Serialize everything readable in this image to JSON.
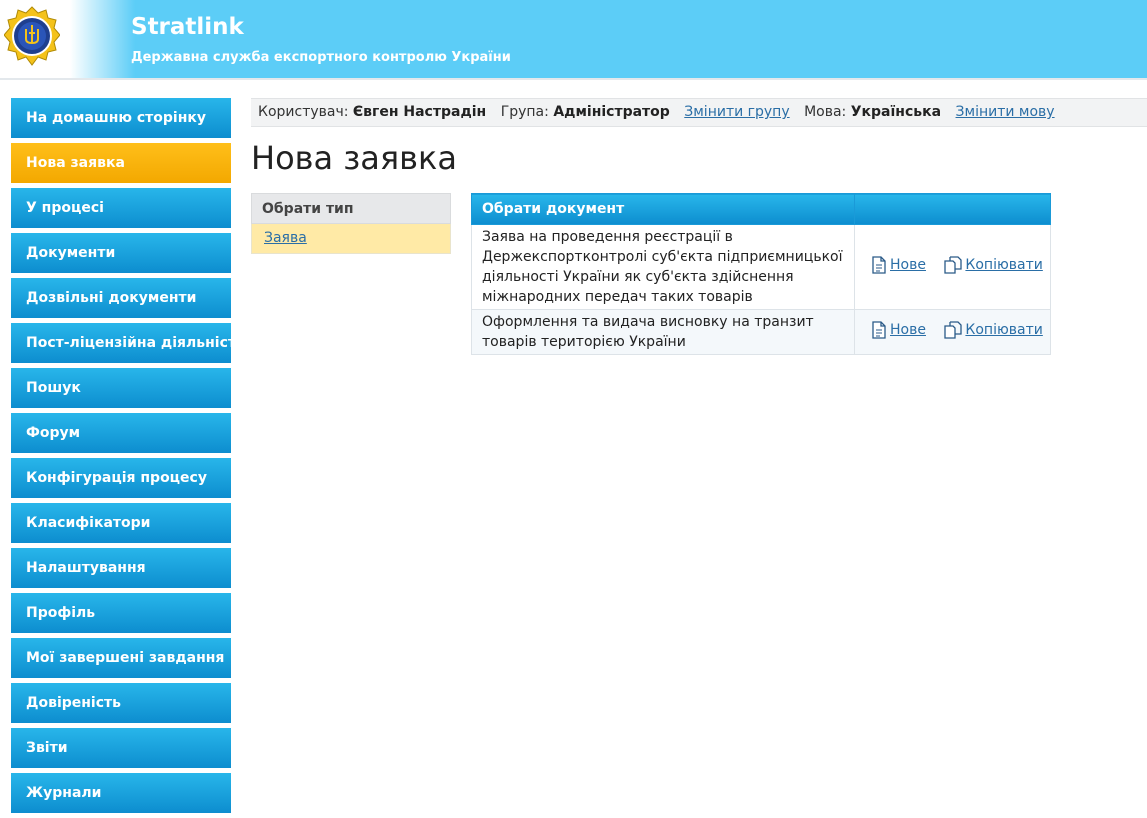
{
  "header": {
    "title": "Stratlink",
    "subtitle": "Державна служба експортного контролю України",
    "logo_icon": "ukraine-trident-emblem-icon"
  },
  "sidebar": {
    "items": [
      {
        "label": "На домашню сторінку",
        "active": false
      },
      {
        "label": "Нова заявка",
        "active": true
      },
      {
        "label": "У процесі",
        "active": false
      },
      {
        "label": "Документи",
        "active": false
      },
      {
        "label": "Дозвільні документи",
        "active": false
      },
      {
        "label": "Пост-ліцензійна діяльність",
        "active": false
      },
      {
        "label": "Пошук",
        "active": false
      },
      {
        "label": "Форум",
        "active": false
      },
      {
        "label": "Конфігурація процесу",
        "active": false
      },
      {
        "label": "Класифікатори",
        "active": false
      },
      {
        "label": "Налаштування",
        "active": false
      },
      {
        "label": "Профіль",
        "active": false
      },
      {
        "label": "Мої завершені завдання",
        "active": false
      },
      {
        "label": "Довіреність",
        "active": false
      },
      {
        "label": "Звіти",
        "active": false
      },
      {
        "label": "Журнали",
        "active": false
      }
    ]
  },
  "userbar": {
    "user_label": "Користувач:",
    "user_name": "Євген Настрадін",
    "group_label": "Група:",
    "group_name": "Адміністратор",
    "change_group": "Змінити групу",
    "lang_label": "Мова:",
    "lang_name": "Українська",
    "change_lang": "Змінити мову"
  },
  "page": {
    "title": "Нова заявка"
  },
  "type_panel": {
    "header": "Обрати тип",
    "items": [
      "Заява"
    ]
  },
  "documents": {
    "header": "Обрати документ",
    "rows": [
      {
        "name": "Заява на проведення реєстрації в Держекспортконтролі суб'єкта підприємницької діяльності України як суб'єкта здійснення міжнародних передач таких товарів",
        "new": "Нове",
        "copy": "Копіювати"
      },
      {
        "name": "Оформлення та видача висновку на транзит товарів територією України",
        "new": "Нове",
        "copy": "Копіювати"
      }
    ]
  },
  "colors": {
    "accent_blue": "#0d8dcf",
    "active_orange": "#f3a800",
    "header_blue": "#5ccdf7",
    "link": "#2a6ea6"
  }
}
